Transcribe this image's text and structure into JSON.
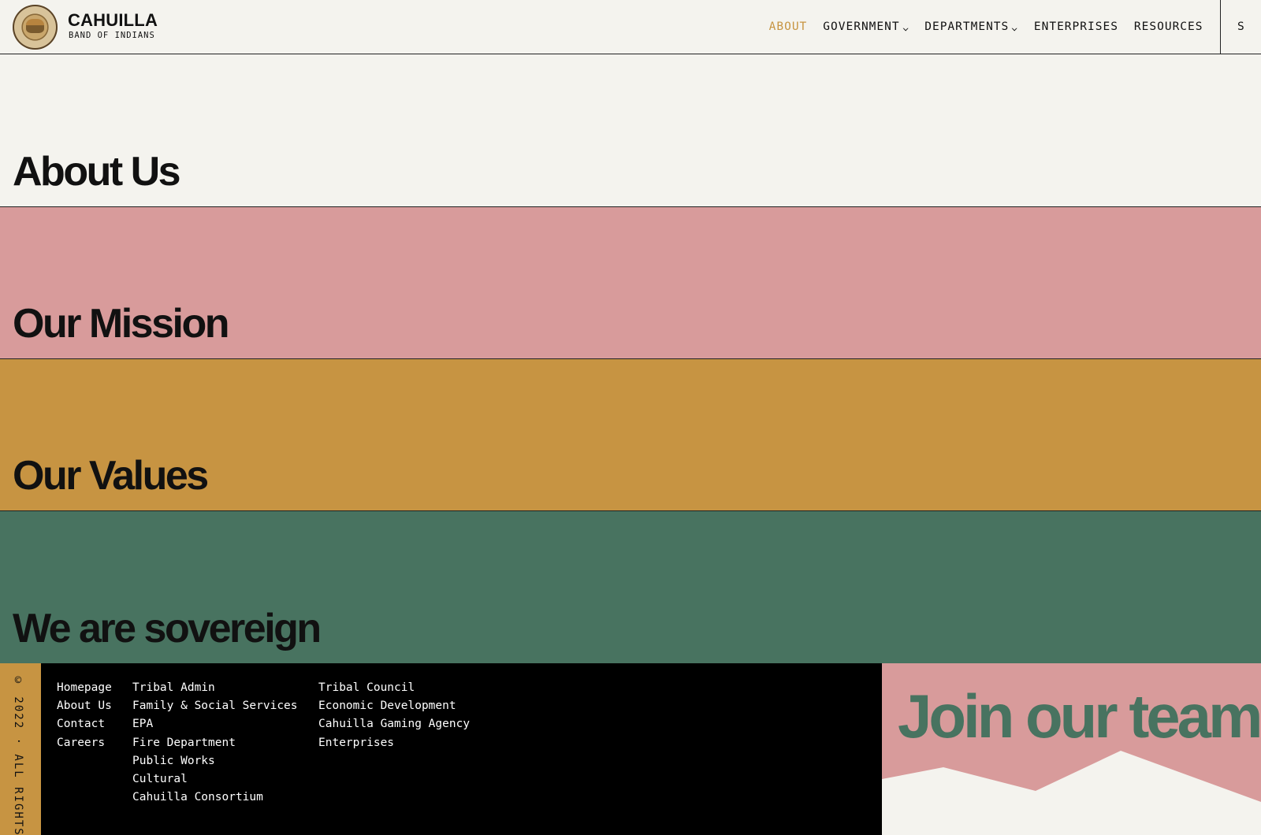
{
  "brand": {
    "title": "CAHUILLA",
    "subtitle": "BAND OF INDIANS"
  },
  "nav": {
    "items": [
      {
        "label": "ABOUT",
        "active": true
      },
      {
        "label": "GOVERNMENT",
        "dropdown": true
      },
      {
        "label": "DEPARTMENTS",
        "dropdown": true
      },
      {
        "label": "ENTERPRISES"
      },
      {
        "label": "RESOURCES"
      }
    ],
    "clipped_label": "S"
  },
  "sections": {
    "about": "About Us",
    "mission": "Our Mission",
    "values": "Our Values",
    "sovereign": "We are sovereign"
  },
  "footer": {
    "copyright": "© 2022 · ALL RIGHTS",
    "col1": [
      "Homepage",
      "About Us",
      "Contact",
      "Careers"
    ],
    "col2": [
      "Tribal Admin",
      "Family & Social Services",
      "EPA",
      "Fire Department",
      "Public Works",
      "Cultural",
      "Cahuilla Consortium"
    ],
    "col3": [
      "Tribal Council",
      "Economic Development",
      "Cahuilla Gaming Agency",
      "Enterprises"
    ],
    "join": "Join our team"
  },
  "colors": {
    "background": "#f4f3ee",
    "pink": "#d89b9b",
    "gold": "#c79442",
    "green": "#487360",
    "footer": "#000000",
    "accent": "#c79542"
  }
}
